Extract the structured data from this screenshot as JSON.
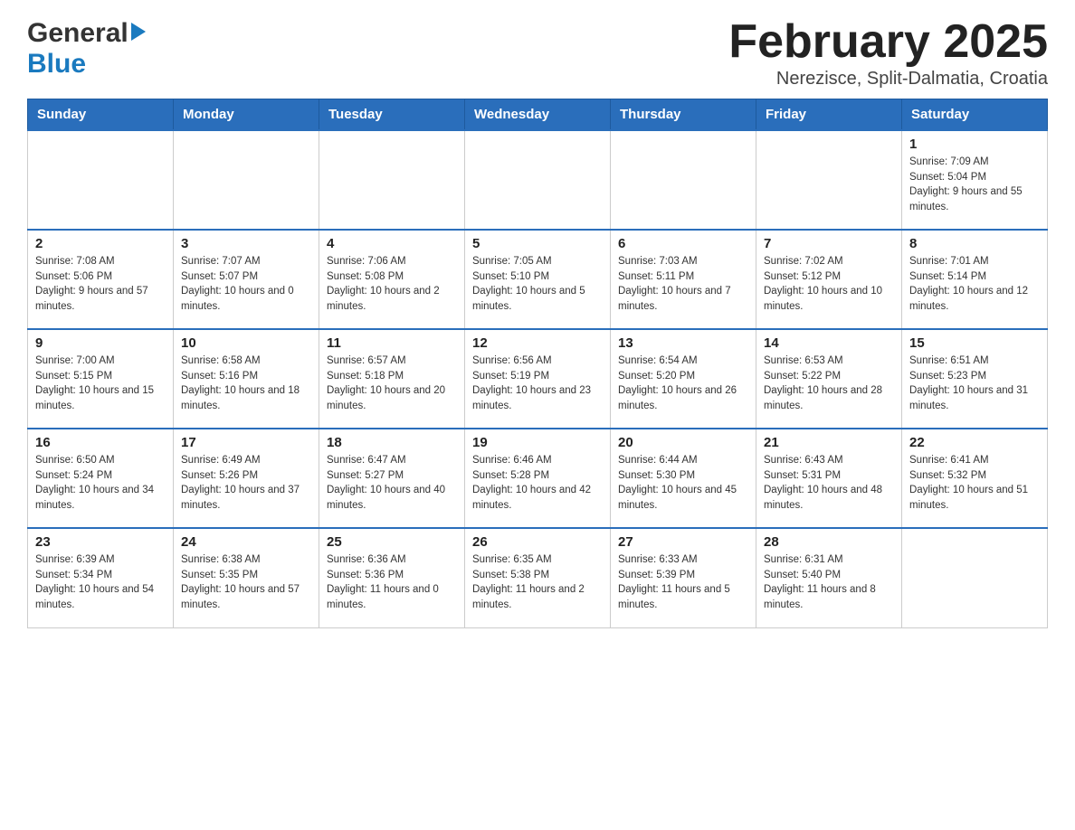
{
  "header": {
    "logo_general": "General",
    "logo_blue": "Blue",
    "month_year": "February 2025",
    "location": "Nerezisce, Split-Dalmatia, Croatia"
  },
  "days_of_week": [
    "Sunday",
    "Monday",
    "Tuesday",
    "Wednesday",
    "Thursday",
    "Friday",
    "Saturday"
  ],
  "weeks": [
    [
      {
        "day": "",
        "info": ""
      },
      {
        "day": "",
        "info": ""
      },
      {
        "day": "",
        "info": ""
      },
      {
        "day": "",
        "info": ""
      },
      {
        "day": "",
        "info": ""
      },
      {
        "day": "",
        "info": ""
      },
      {
        "day": "1",
        "info": "Sunrise: 7:09 AM\nSunset: 5:04 PM\nDaylight: 9 hours and 55 minutes."
      }
    ],
    [
      {
        "day": "2",
        "info": "Sunrise: 7:08 AM\nSunset: 5:06 PM\nDaylight: 9 hours and 57 minutes."
      },
      {
        "day": "3",
        "info": "Sunrise: 7:07 AM\nSunset: 5:07 PM\nDaylight: 10 hours and 0 minutes."
      },
      {
        "day": "4",
        "info": "Sunrise: 7:06 AM\nSunset: 5:08 PM\nDaylight: 10 hours and 2 minutes."
      },
      {
        "day": "5",
        "info": "Sunrise: 7:05 AM\nSunset: 5:10 PM\nDaylight: 10 hours and 5 minutes."
      },
      {
        "day": "6",
        "info": "Sunrise: 7:03 AM\nSunset: 5:11 PM\nDaylight: 10 hours and 7 minutes."
      },
      {
        "day": "7",
        "info": "Sunrise: 7:02 AM\nSunset: 5:12 PM\nDaylight: 10 hours and 10 minutes."
      },
      {
        "day": "8",
        "info": "Sunrise: 7:01 AM\nSunset: 5:14 PM\nDaylight: 10 hours and 12 minutes."
      }
    ],
    [
      {
        "day": "9",
        "info": "Sunrise: 7:00 AM\nSunset: 5:15 PM\nDaylight: 10 hours and 15 minutes."
      },
      {
        "day": "10",
        "info": "Sunrise: 6:58 AM\nSunset: 5:16 PM\nDaylight: 10 hours and 18 minutes."
      },
      {
        "day": "11",
        "info": "Sunrise: 6:57 AM\nSunset: 5:18 PM\nDaylight: 10 hours and 20 minutes."
      },
      {
        "day": "12",
        "info": "Sunrise: 6:56 AM\nSunset: 5:19 PM\nDaylight: 10 hours and 23 minutes."
      },
      {
        "day": "13",
        "info": "Sunrise: 6:54 AM\nSunset: 5:20 PM\nDaylight: 10 hours and 26 minutes."
      },
      {
        "day": "14",
        "info": "Sunrise: 6:53 AM\nSunset: 5:22 PM\nDaylight: 10 hours and 28 minutes."
      },
      {
        "day": "15",
        "info": "Sunrise: 6:51 AM\nSunset: 5:23 PM\nDaylight: 10 hours and 31 minutes."
      }
    ],
    [
      {
        "day": "16",
        "info": "Sunrise: 6:50 AM\nSunset: 5:24 PM\nDaylight: 10 hours and 34 minutes."
      },
      {
        "day": "17",
        "info": "Sunrise: 6:49 AM\nSunset: 5:26 PM\nDaylight: 10 hours and 37 minutes."
      },
      {
        "day": "18",
        "info": "Sunrise: 6:47 AM\nSunset: 5:27 PM\nDaylight: 10 hours and 40 minutes."
      },
      {
        "day": "19",
        "info": "Sunrise: 6:46 AM\nSunset: 5:28 PM\nDaylight: 10 hours and 42 minutes."
      },
      {
        "day": "20",
        "info": "Sunrise: 6:44 AM\nSunset: 5:30 PM\nDaylight: 10 hours and 45 minutes."
      },
      {
        "day": "21",
        "info": "Sunrise: 6:43 AM\nSunset: 5:31 PM\nDaylight: 10 hours and 48 minutes."
      },
      {
        "day": "22",
        "info": "Sunrise: 6:41 AM\nSunset: 5:32 PM\nDaylight: 10 hours and 51 minutes."
      }
    ],
    [
      {
        "day": "23",
        "info": "Sunrise: 6:39 AM\nSunset: 5:34 PM\nDaylight: 10 hours and 54 minutes."
      },
      {
        "day": "24",
        "info": "Sunrise: 6:38 AM\nSunset: 5:35 PM\nDaylight: 10 hours and 57 minutes."
      },
      {
        "day": "25",
        "info": "Sunrise: 6:36 AM\nSunset: 5:36 PM\nDaylight: 11 hours and 0 minutes."
      },
      {
        "day": "26",
        "info": "Sunrise: 6:35 AM\nSunset: 5:38 PM\nDaylight: 11 hours and 2 minutes."
      },
      {
        "day": "27",
        "info": "Sunrise: 6:33 AM\nSunset: 5:39 PM\nDaylight: 11 hours and 5 minutes."
      },
      {
        "day": "28",
        "info": "Sunrise: 6:31 AM\nSunset: 5:40 PM\nDaylight: 11 hours and 8 minutes."
      },
      {
        "day": "",
        "info": ""
      }
    ]
  ]
}
